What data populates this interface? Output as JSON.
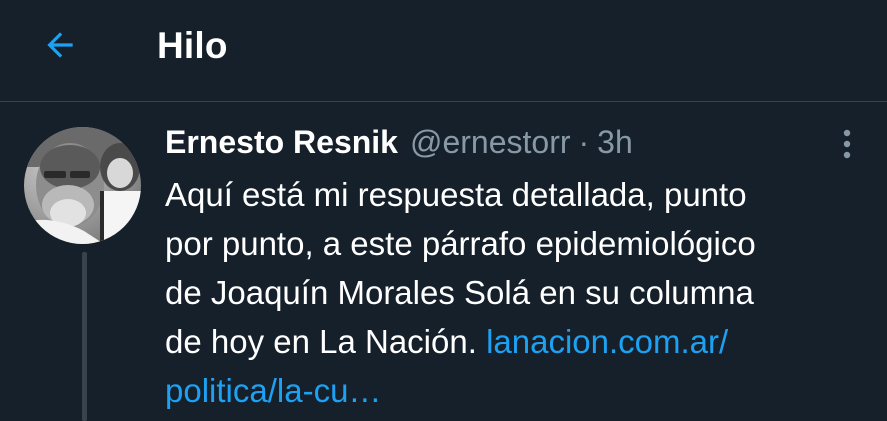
{
  "header": {
    "back_icon": "arrow-left-icon",
    "title": "Hilo"
  },
  "tweet": {
    "author_name": "Ernesto Resnik",
    "author_handle": "@ernestorr",
    "separator": "·",
    "time": "3h",
    "more_icon": "more-vertical-icon",
    "avatar_icon": "user-avatar",
    "text_lines": [
      "Aquí está mi respuesta detallada, punto",
      "por punto, a este  párrafo epidemiológico",
      "de Joaquín Morales Solá en su columna"
    ],
    "last_line_text": "de hoy en La Nación. ",
    "link_part1": "lanacion.com.ar/",
    "link_part2": "politica/la-cu…"
  },
  "colors": {
    "background": "#15202b",
    "text": "#ffffff",
    "secondary_text": "#8899a6",
    "accent": "#1da1f2",
    "divider": "#38444d"
  }
}
